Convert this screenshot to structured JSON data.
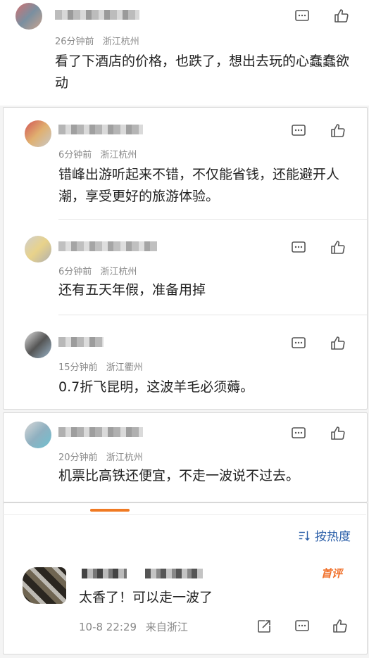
{
  "colors": {
    "link_blue": "#2a5ea8",
    "accent_orange": "#f07a23",
    "meta_gray": "#888888"
  },
  "top_comment": {
    "time": "26分钟前",
    "location": "浙江杭州",
    "text": "看了下酒店的价格，也跌了，想出去玩的心蠢蠢欲动"
  },
  "reply_group_1": [
    {
      "time": "6分钟前",
      "location": "浙江杭州",
      "text": "错峰出游听起来不错，不仅能省钱，还能避开人潮，享受更好的旅游体验。"
    },
    {
      "time": "6分钟前",
      "location": "浙江杭州",
      "text": "还有五天年假，准备用掉"
    },
    {
      "time": "15分钟前",
      "location": "浙江衢州",
      "text": "0.7折飞昆明，这波羊毛必须薅。"
    }
  ],
  "reply_group_2": [
    {
      "time": "20分钟前",
      "location": "浙江杭州",
      "text": "机票比高铁还便宜，不走一波说不过去。"
    }
  ],
  "sort": {
    "label": "按热度",
    "icon": "sort-icon"
  },
  "featured": {
    "badge": "首评",
    "text": "太香了！可以走一波了",
    "date": "10-8 22:29",
    "source": "来自浙江"
  }
}
